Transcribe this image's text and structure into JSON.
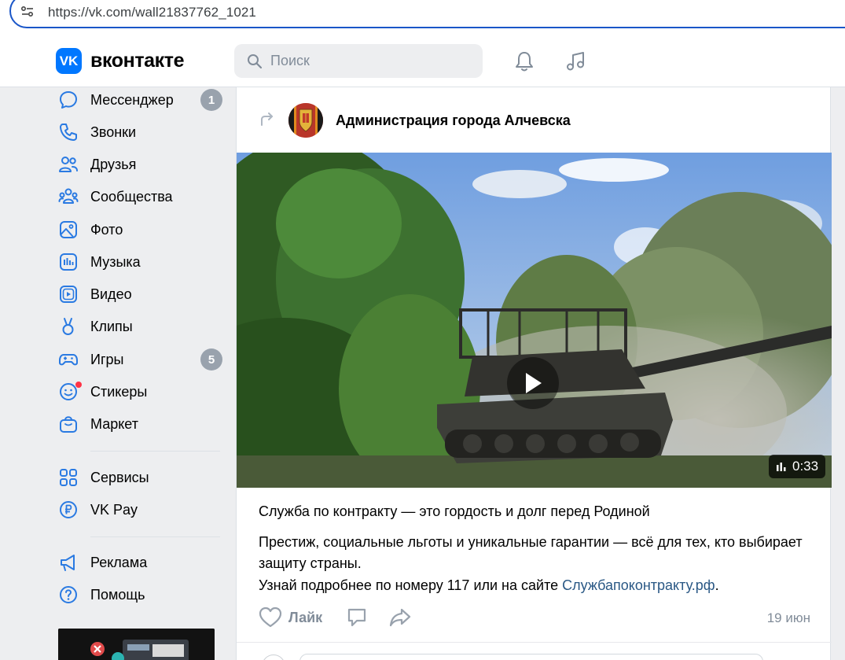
{
  "browser": {
    "url": "https://vk.com/wall21837762_1021"
  },
  "header": {
    "logo_mark": "VK",
    "logo_text": "вконтакте",
    "search_placeholder": "Поиск"
  },
  "sidebar": {
    "items": [
      {
        "label": "Мессенджер",
        "icon": "message-icon",
        "badge": "1"
      },
      {
        "label": "Звонки",
        "icon": "phone-icon"
      },
      {
        "label": "Друзья",
        "icon": "friends-icon"
      },
      {
        "label": "Сообщества",
        "icon": "communities-icon"
      },
      {
        "label": "Фото",
        "icon": "photo-icon"
      },
      {
        "label": "Музыка",
        "icon": "music-icon"
      },
      {
        "label": "Видео",
        "icon": "video-icon"
      },
      {
        "label": "Клипы",
        "icon": "clips-icon"
      },
      {
        "label": "Игры",
        "icon": "games-icon",
        "badge": "5"
      },
      {
        "label": "Стикеры",
        "icon": "stickers-icon"
      },
      {
        "label": "Маркет",
        "icon": "market-icon"
      }
    ],
    "items2": [
      {
        "label": "Сервисы",
        "icon": "services-icon"
      },
      {
        "label": "VK Pay",
        "icon": "vkpay-icon"
      }
    ],
    "items3": [
      {
        "label": "Реклама",
        "icon": "ads-icon"
      },
      {
        "label": "Помощь",
        "icon": "help-icon"
      }
    ]
  },
  "post": {
    "author": "Администрация города Алчевска",
    "video_duration": "0:33",
    "headline": "Служба по контракту — это гордость и долг перед Родиной",
    "body_line1": "Престиж, социальные льготы и уникальные гарантии — всё для тех, кто выбирает защиту страны.",
    "body_line2_prefix": "Узнай подробнее по номеру 117 или на сайте ",
    "body_link": "Службапоконтракту.рф",
    "body_line2_suffix": ".",
    "like_label": "Лайк",
    "date": "19 июн"
  },
  "colors": {
    "accent": "#0077ff",
    "link": "#2a5885",
    "muted": "#818c99",
    "badge": "#99a2ad",
    "notification_dot": "#ff3347"
  }
}
